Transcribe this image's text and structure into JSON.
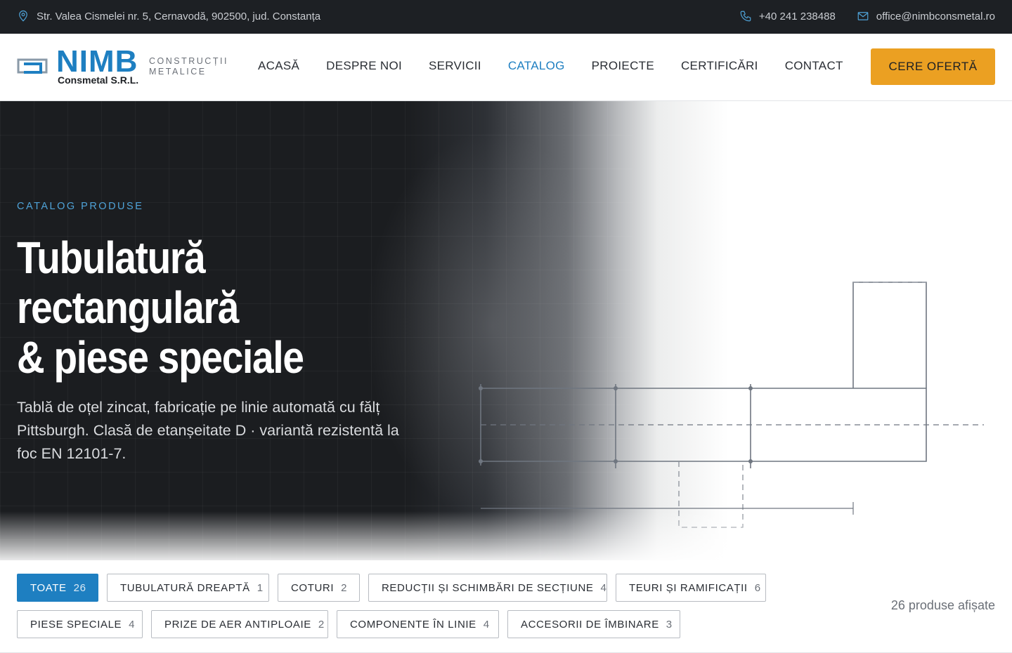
{
  "topbar": {
    "address": "Str. Valea Cismelei nr. 5, Cernavodă, 902500, jud. Constanța",
    "phone": "+40 241 238488",
    "email": "office@nimbconsmetal.ro",
    "icons": [
      "map-pin-icon",
      "phone-icon",
      "mail-icon"
    ]
  },
  "logo": {
    "name": "NIMB",
    "company": "Consmetal S.R.L.",
    "tagline_line1": "CONSTRUCȚII",
    "tagline_line2": "METALICE"
  },
  "nav": {
    "items": [
      {
        "label": "ACASĂ",
        "active": false
      },
      {
        "label": "DESPRE NOI",
        "active": false
      },
      {
        "label": "SERVICII",
        "active": false
      },
      {
        "label": "CATALOG",
        "active": true
      },
      {
        "label": "PROIECTE",
        "active": false
      },
      {
        "label": "CERTIFICĂRI",
        "active": false
      },
      {
        "label": "CONTACT",
        "active": false
      }
    ],
    "cta": "CERE OFERTĂ"
  },
  "hero": {
    "kicker": "CATALOG PRODUSE",
    "title_line1": "Tubulatură",
    "title_line2": "rectangulară",
    "title_line3": "& piese speciale",
    "lead": "Tablă de oțel zincat, fabricație pe linie automată cu fălț Pittsburgh. Clasă de etanșeitate D · variantă rezistentă la foc EN 12101-7."
  },
  "filters": {
    "chips": [
      {
        "label": "TOATE",
        "count": "26",
        "active": true
      },
      {
        "label": "TUBULATURĂ DREAPTĂ",
        "count": "1",
        "active": false
      },
      {
        "label": "COTURI",
        "count": "2",
        "active": false
      },
      {
        "label": "REDUCȚII ȘI SCHIMBĂRI DE SECȚIUNE",
        "count": "4",
        "active": false
      },
      {
        "label": "TEURI ȘI RAMIFICAȚII",
        "count": "6",
        "active": false
      },
      {
        "label": "PIESE SPECIALE",
        "count": "4",
        "active": false
      },
      {
        "label": "PRIZE DE AER ANTIPLOAIE",
        "count": "2",
        "active": false
      },
      {
        "label": "COMPONENTE ÎN LINIE",
        "count": "4",
        "active": false
      },
      {
        "label": "ACCESORII DE ÎMBINARE",
        "count": "3",
        "active": false
      }
    ],
    "shown_text": "26 produse afișate"
  },
  "colors": {
    "accent": "#1e7fc1",
    "cta": "#eba022",
    "dark": "#1d2024"
  }
}
